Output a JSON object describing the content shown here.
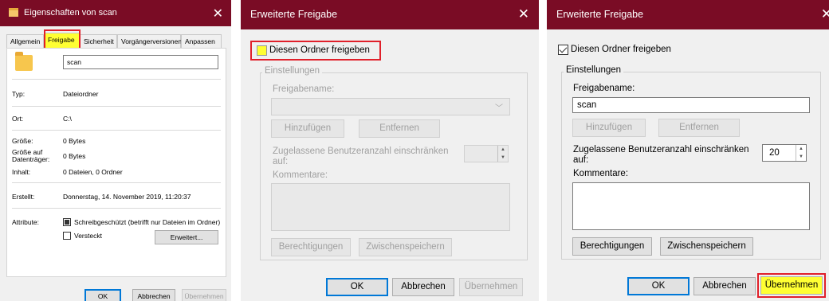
{
  "props": {
    "title": "Eigenschaften von scan",
    "tabs": [
      "Allgemein",
      "Freigabe",
      "Sicherheit",
      "Vorgängerversionen",
      "Anpassen"
    ],
    "name": "scan",
    "labels": {
      "typ": "Typ:",
      "ort": "Ort:",
      "groesse": "Größe:",
      "groesse_auf": "Größe auf Datenträger:",
      "inhalt": "Inhalt:",
      "erstellt": "Erstellt:",
      "attribute": "Attribute:"
    },
    "values": {
      "typ": "Dateiordner",
      "ort": "C:\\",
      "groesse": "0 Bytes",
      "groesse_auf": "0 Bytes",
      "inhalt": "0 Dateien, 0 Ordner",
      "erstellt": "Donnerstag, 14. November 2019, 11:20:37"
    },
    "attr_readonly": "Schreibgeschützt (betrifft nur Dateien im Ordner)",
    "attr_hidden": "Versteckt",
    "erweitert": "Erweitert...",
    "ok": "OK",
    "cancel": "Abbrechen",
    "apply": "Übernehmen"
  },
  "share1": {
    "title": "Erweiterte Freigabe",
    "share_checkbox": "Diesen Ordner freigeben",
    "settings": "Einstellungen",
    "share_name_label": "Freigabename:",
    "share_name_value": "",
    "add": "Hinzufügen",
    "remove": "Entfernen",
    "limit_label": "Zugelassene Benutzeranzahl einschränken auf:",
    "limit_value": "",
    "comments_label": "Kommentare:",
    "permissions": "Berechtigungen",
    "caching": "Zwischenspeichern",
    "ok": "OK",
    "cancel": "Abbrechen",
    "apply": "Übernehmen"
  },
  "share2": {
    "title": "Erweiterte Freigabe",
    "share_checkbox": "Diesen Ordner freigeben",
    "settings": "Einstellungen",
    "share_name_label": "Freigabename:",
    "share_name_value": "scan",
    "add": "Hinzufügen",
    "remove": "Entfernen",
    "limit_label": "Zugelassene Benutzeranzahl einschränken auf:",
    "limit_value": "20",
    "comments_label": "Kommentare:",
    "permissions": "Berechtigungen",
    "caching": "Zwischenspeichern",
    "ok": "OK",
    "cancel": "Abbrechen",
    "apply": "Übernehmen"
  },
  "colors": {
    "titlebar": "#7a0c25",
    "highlight": "#ffff33",
    "redbox": "#e0202a",
    "accent": "#0078d7"
  }
}
